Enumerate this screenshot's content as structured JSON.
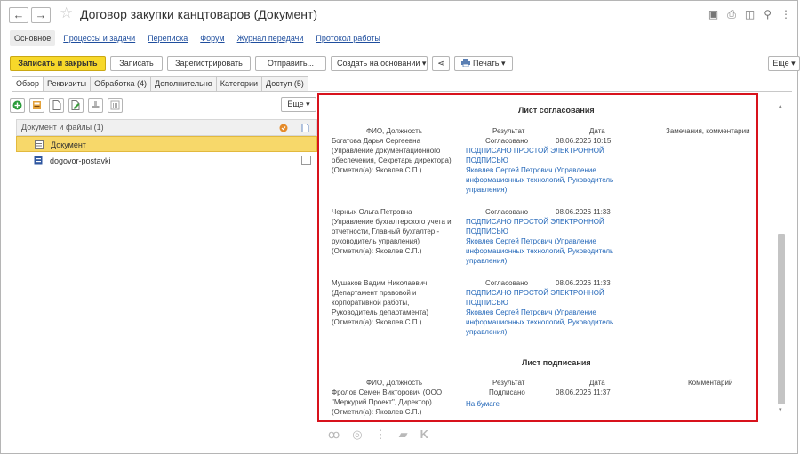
{
  "window": {
    "title": "Договор закупки канцтоваров (Документ)",
    "back": "←",
    "forward": "→",
    "star": "☆",
    "icons": [
      "save-icon",
      "print-icon",
      "preview-icon",
      "link-icon",
      "more-icon"
    ],
    "icon_glyphs": [
      "▣",
      "⎙",
      "◫",
      "⚲",
      "⋮"
    ]
  },
  "nav_tabs": [
    {
      "label": "Основное"
    },
    {
      "label": "Процессы и задачи"
    },
    {
      "label": "Переписка"
    },
    {
      "label": "Форум"
    },
    {
      "label": "Журнал передачи"
    },
    {
      "label": "Протокол работы"
    }
  ],
  "toolbar": {
    "save_close": "Записать и закрыть",
    "save": "Записать",
    "register": "Зарегистрировать",
    "send": "Отправить...",
    "create_based": "Создать на основании",
    "create_based_arrow": "▾",
    "share": "⋖",
    "print": "Печать",
    "print_arrow": "▾",
    "more": "Еще",
    "more_arrow": "▾"
  },
  "inner_tabs": [
    {
      "label": "Обзор"
    },
    {
      "label": "Реквизиты"
    },
    {
      "label": "Обработка (4)"
    },
    {
      "label": "Дополнительно"
    },
    {
      "label": "Категории"
    },
    {
      "label": "Доступ (5)"
    }
  ],
  "left_panel": {
    "more": "Еще",
    "more_arrow": "▾",
    "list_header": "Документ и файлы (1)",
    "rows": [
      {
        "label": "Документ"
      },
      {
        "label": "dogovor-postavki"
      }
    ]
  },
  "approval_sheet": {
    "title": "Лист согласования",
    "headers": {
      "person": "ФИО, Должность",
      "result": "Результат",
      "date": "Дата",
      "remarks": "Замечания, комментарии"
    },
    "entries": [
      {
        "person": "Богатова Дарья Сергеевна\n(Управление документационного\nобеспечения, Секретарь директора)\n(Отметил(а): Яковлев С.П.)",
        "result": "Согласовано",
        "date": "08.06.2026 10:15",
        "signature": "ПОДПИСАНО ПРОСТОЙ ЭЛЕКТРОННОЙ\nПОДПИСЬЮ",
        "signer": "Яковлев Сергей Петрович (Управление\nинформационных технологий, Руководитель\nуправления)"
      },
      {
        "person": "Черных Ольга Петровна\n(Управление бухгалтерского учета и\nотчетности, Главный бухгалтер -\nруководитель управления)\n(Отметил(а): Яковлев С.П.)",
        "result": "Согласовано",
        "date": "08.06.2026 11:33",
        "signature": "ПОДПИСАНО ПРОСТОЙ ЭЛЕКТРОННОЙ\nПОДПИСЬЮ",
        "signer": "Яковлев Сергей Петрович (Управление\nинформационных технологий, Руководитель\nуправления)"
      },
      {
        "person": "Мушаков Вадим Николаевич\n(Департамент правовой и\nкорпоративной работы,\nРуководитель департамента)\n(Отметил(а): Яковлев С.П.)",
        "result": "Согласовано",
        "date": "08.06.2026 11:33",
        "signature": "ПОДПИСАНО ПРОСТОЙ ЭЛЕКТРОННОЙ\nПОДПИСЬЮ",
        "signer": "Яковлев Сергей Петрович (Управление\nинформационных технологий, Руководитель\nуправления)"
      }
    ]
  },
  "signing_sheet": {
    "title": "Лист подписания",
    "headers": {
      "person": "ФИО, Должность",
      "result": "Результат",
      "date": "Дата",
      "comment": "Комментарий"
    },
    "entry": {
      "person": "Фролов Семен Викторович (ООО\n\"Меркурий Проект\", Директор)\n(Отметил(а): Яковлев С.П.)",
      "result": "Подписано",
      "date": "08.06.2026 11:37",
      "signature": "На бумаге"
    }
  },
  "bottom_icons": [
    "people-icon",
    "target-icon",
    "tree-icon",
    "chat-icon",
    "k-icon"
  ],
  "bottom_glyphs": [
    "ꝏ",
    "◎",
    "⋮",
    "▰",
    "K"
  ],
  "colors": {
    "accent": "#f7d82a",
    "selection": "#f7d86a",
    "highlight_border": "#d8121c",
    "link": "#1f4e9e"
  }
}
